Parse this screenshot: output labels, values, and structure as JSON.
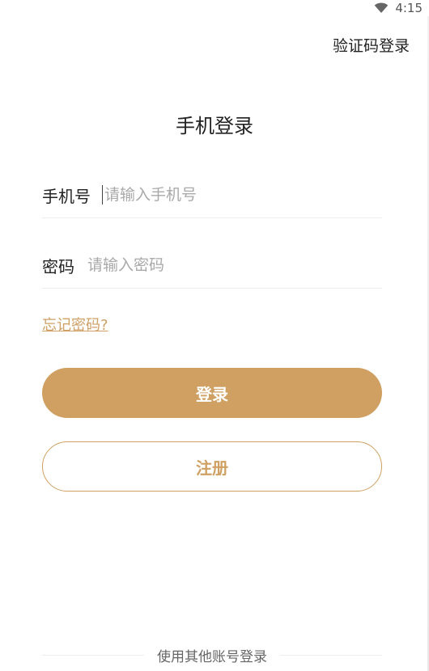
{
  "status_bar": {
    "time": "4:15",
    "wifi_icon": "wifi-icon"
  },
  "header": {
    "switch_login_label": "验证码登录"
  },
  "main": {
    "title": "手机登录",
    "phone": {
      "label": "手机号",
      "placeholder": "请输入手机号",
      "value": ""
    },
    "password": {
      "label": "密码",
      "placeholder": "请输入密码",
      "value": ""
    },
    "forgot_label": "忘记密码?",
    "login_button": "登录",
    "register_button": "注册"
  },
  "footer": {
    "other_login_label": "使用其他账号登录"
  },
  "colors": {
    "accent": "#cfa062",
    "link": "#cfa065",
    "text": "#222222",
    "placeholder": "#a9a9a9",
    "divider": "#ececec"
  }
}
